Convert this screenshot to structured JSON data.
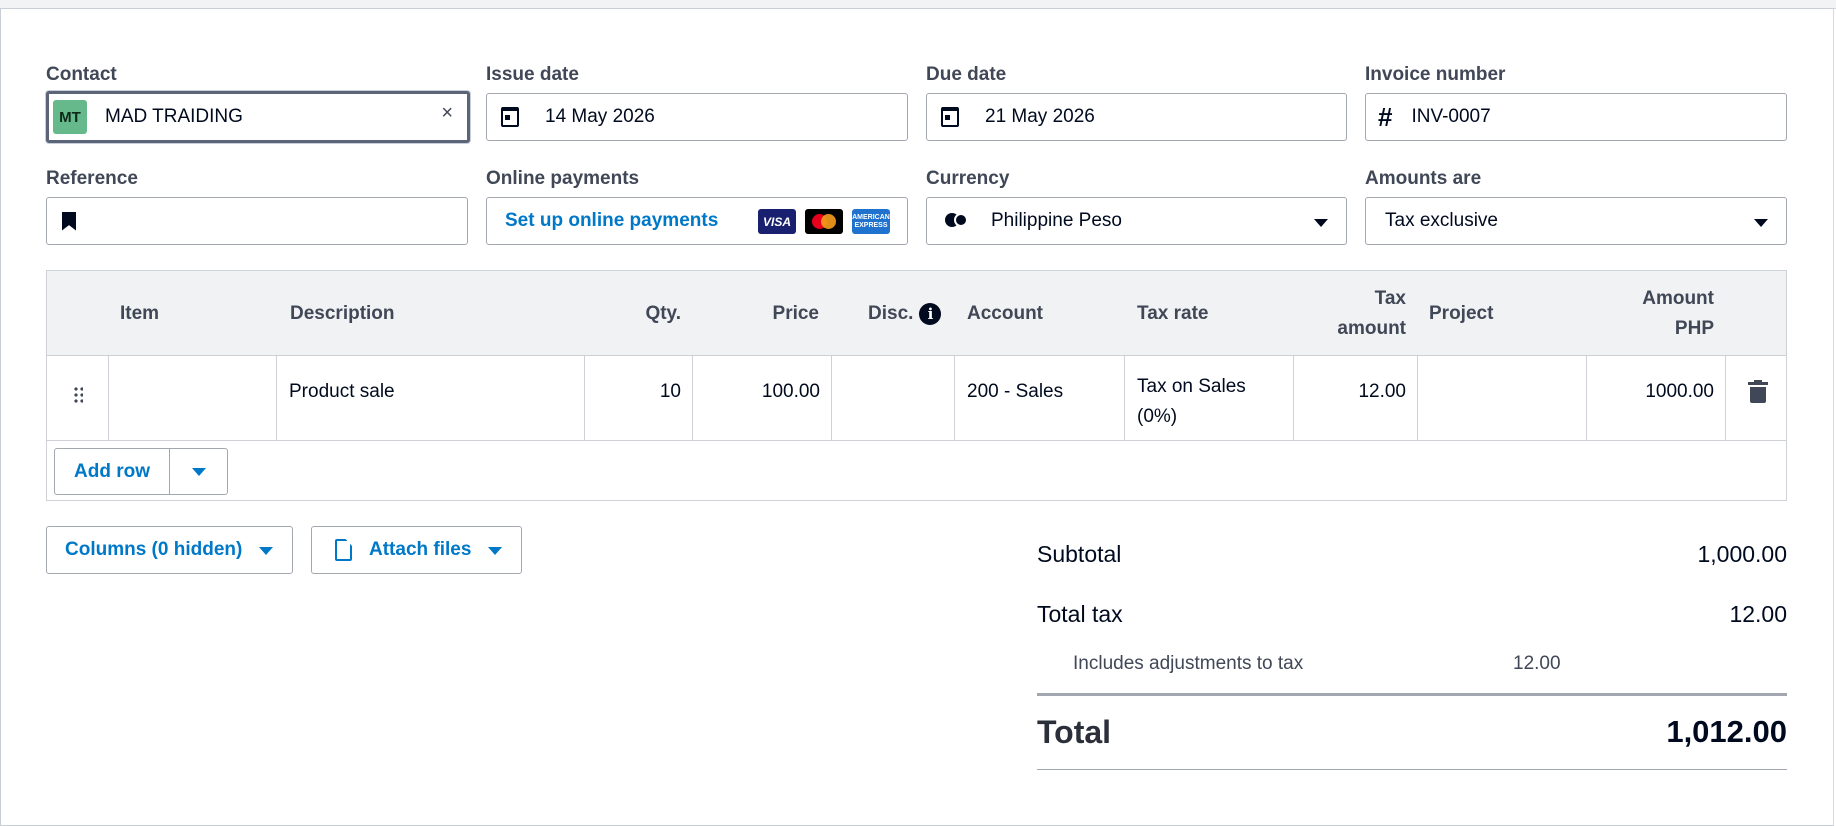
{
  "fields": {
    "contact": {
      "label": "Contact",
      "avatar": "MT",
      "value": "MAD TRAIDING",
      "clear": "×"
    },
    "issue_date": {
      "label": "Issue date",
      "value": "14 May 2026"
    },
    "due_date": {
      "label": "Due date",
      "value": "21 May 2026"
    },
    "invoice_number": {
      "label": "Invoice number",
      "prefix": "#",
      "value": "INV-0007"
    },
    "reference": {
      "label": "Reference",
      "value": ""
    },
    "online_payments": {
      "label": "Online payments",
      "link": "Set up online payments",
      "card1": "VISA",
      "card3": "AMERICAN EXPRESS"
    },
    "currency": {
      "label": "Currency",
      "value": "Philippine Peso"
    },
    "amounts_are": {
      "label": "Amounts are",
      "value": "Tax exclusive"
    }
  },
  "table": {
    "headers": {
      "item": "Item",
      "description": "Description",
      "qty": "Qty.",
      "price": "Price",
      "disc": "Disc.",
      "disc_info": "i",
      "account": "Account",
      "tax_rate": "Tax rate",
      "tax_amount_1": "Tax",
      "tax_amount_2": "amount",
      "project": "Project",
      "amount_1": "Amount",
      "amount_2": "PHP"
    },
    "rows": [
      {
        "item": "",
        "description": "Product sale",
        "qty": "10",
        "price": "100.00",
        "disc": "",
        "account": "200 - Sales",
        "tax_rate_1": "Tax on Sales",
        "tax_rate_2": "(0%)",
        "tax_amount": "12.00",
        "project": "",
        "amount": "1000.00"
      }
    ],
    "add_row_label": "Add row"
  },
  "buttons": {
    "columns": "Columns (0 hidden)",
    "attach": "Attach files"
  },
  "totals": {
    "subtotal_label": "Subtotal",
    "subtotal_value": "1,000.00",
    "total_tax_label": "Total tax",
    "total_tax_value": "12.00",
    "adjustments_label": "Includes adjustments to tax",
    "adjustments_value": "12.00",
    "total_label": "Total",
    "total_value": "1,012.00"
  },
  "colors": {
    "link": "#0078c8",
    "avatar_bg": "#66b98a",
    "text": "#000a1e",
    "label": "#404756"
  }
}
